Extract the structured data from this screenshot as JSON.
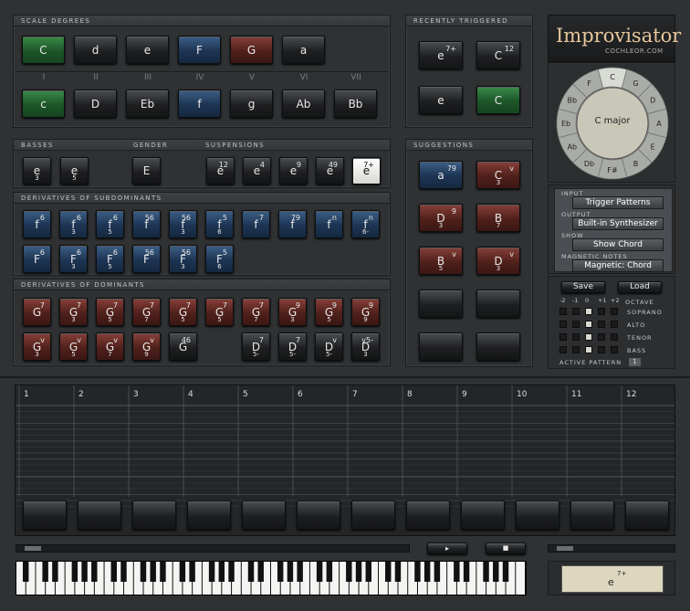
{
  "scale_degrees": {
    "title": "SCALE DEGREES",
    "top": [
      {
        "label": "C",
        "color": "g"
      },
      {
        "label": "d",
        "color": ""
      },
      {
        "label": "e",
        "color": ""
      },
      {
        "label": "F",
        "color": "b"
      },
      {
        "label": "G",
        "color": "rd"
      },
      {
        "label": "a",
        "color": ""
      }
    ],
    "numerals": [
      "I",
      "II",
      "III",
      "IV",
      "V",
      "VI",
      "VII"
    ],
    "bottom": [
      {
        "label": "c",
        "color": "g"
      },
      {
        "label": "D",
        "color": ""
      },
      {
        "label": "Eb",
        "color": ""
      },
      {
        "label": "f",
        "color": "b"
      },
      {
        "label": "g",
        "color": ""
      },
      {
        "label": "Ab",
        "color": ""
      },
      {
        "label": "Bb",
        "color": ""
      }
    ]
  },
  "recently": {
    "title": "RECENTLY TRIGGERED",
    "items": [
      {
        "r": "e",
        "sp": "7+",
        "sb": "",
        "color": ""
      },
      {
        "r": "C",
        "sp": "12",
        "sb": "",
        "color": ""
      },
      {
        "r": "e",
        "sp": "",
        "sb": "",
        "color": ""
      },
      {
        "r": "C",
        "sp": "",
        "sb": "",
        "color": "g"
      }
    ]
  },
  "brand": {
    "title": "Improvisator",
    "site": "COCHLEOR.COM"
  },
  "key_circle": {
    "center": "C major",
    "notes": [
      "C",
      "G",
      "D",
      "A",
      "E",
      "B",
      "F#",
      "Db",
      "Ab",
      "Eb",
      "Bb",
      "F"
    ]
  },
  "basses": {
    "title": "BASSES",
    "items": [
      {
        "r": "e",
        "sb": "3"
      },
      {
        "r": "e",
        "sb": "5"
      }
    ]
  },
  "gender": {
    "title": "GENDER",
    "item": "E"
  },
  "suspensions": {
    "title": "SUSPENSIONS",
    "items": [
      {
        "r": "e",
        "sp": "12",
        "w": false
      },
      {
        "r": "e",
        "sp": "4",
        "w": false
      },
      {
        "r": "e",
        "sp": "9",
        "w": false
      },
      {
        "r": "e",
        "sp": "49",
        "w": false
      },
      {
        "r": "e",
        "sp": "7+",
        "w": true
      }
    ]
  },
  "suggestions": {
    "title": "SUGGESTIONS",
    "items": [
      {
        "r": "a",
        "sp": "79",
        "sb": "",
        "color": "b"
      },
      {
        "r": "C",
        "sp": "v",
        "sb": "3",
        "color": "rd"
      },
      {
        "r": "D",
        "sp": "9",
        "sb": "3",
        "color": "rd"
      },
      {
        "r": "B",
        "sp": "",
        "sb": "7",
        "color": "rd"
      },
      {
        "r": "B",
        "sp": "v",
        "sb": "5",
        "color": "rd"
      },
      {
        "r": "D",
        "sp": "v",
        "sb": "3",
        "color": "rd"
      },
      {
        "r": "",
        "sp": "",
        "sb": "",
        "color": ""
      },
      {
        "r": "",
        "sp": "",
        "sb": "",
        "color": ""
      },
      {
        "r": "",
        "sp": "",
        "sb": "",
        "color": ""
      },
      {
        "r": "",
        "sp": "",
        "sb": "",
        "color": ""
      }
    ]
  },
  "subdominants": {
    "title": "DERIVATIVES OF SUBDOMINANTS",
    "row1": [
      {
        "r": "f",
        "sp": "6",
        "sb": ""
      },
      {
        "r": "f",
        "sp": "6",
        "sb": "3"
      },
      {
        "r": "f",
        "sp": "6",
        "sb": "5"
      },
      {
        "r": "f",
        "sp": "56",
        "sb": ""
      },
      {
        "r": "f",
        "sp": "56",
        "sb": "3"
      },
      {
        "r": "f",
        "sp": "5",
        "sb": "6"
      },
      {
        "r": "f",
        "sp": "7",
        "sb": ""
      },
      {
        "r": "f",
        "sp": "79",
        "sb": ""
      },
      {
        "r": "f",
        "sp": "n",
        "sb": ""
      },
      {
        "r": "f",
        "sp": "n",
        "sb": "6-"
      }
    ],
    "row2": [
      {
        "r": "F",
        "sp": "6",
        "sb": ""
      },
      {
        "r": "F",
        "sp": "6",
        "sb": "3"
      },
      {
        "r": "F",
        "sp": "6",
        "sb": "5"
      },
      {
        "r": "F",
        "sp": "56",
        "sb": ""
      },
      {
        "r": "F",
        "sp": "56",
        "sb": "3"
      },
      {
        "r": "F",
        "sp": "5",
        "sb": "6"
      }
    ]
  },
  "dominants": {
    "title": "DERIVATIVES OF DOMINANTS",
    "row1": [
      {
        "r": "G",
        "sp": "7",
        "sb": ""
      },
      {
        "r": "G",
        "sp": "7",
        "sb": "3"
      },
      {
        "r": "G",
        "sp": "7",
        "sb": "5"
      },
      {
        "r": "G",
        "sp": "7",
        "sb": "7"
      },
      {
        "r": "G",
        "sp": "7",
        "sb": "5"
      },
      {
        "r": "G",
        "sp": "7",
        "sb": "5"
      },
      {
        "r": "G",
        "sp": "7",
        "sb": "7"
      },
      {
        "r": "G",
        "sp": "9",
        "sb": "3"
      },
      {
        "r": "G",
        "sp": "9",
        "sb": "5"
      },
      {
        "r": "G",
        "sp": "9",
        "sb": "9"
      }
    ],
    "row2": [
      {
        "r": "G",
        "sp": "v",
        "sb": "3",
        "c": "rd"
      },
      {
        "r": "G",
        "sp": "v",
        "sb": "5",
        "c": "rd"
      },
      {
        "r": "G",
        "sp": "v",
        "sb": "7",
        "c": "rd"
      },
      {
        "r": "G",
        "sp": "v",
        "sb": "9",
        "c": "rd"
      },
      {
        "r": "G",
        "sp": "46",
        "sb": "",
        "c": ""
      },
      {
        "r": "D",
        "sp": "7",
        "sb": "5-",
        "c": ""
      },
      {
        "r": "D",
        "sp": "7",
        "sb": "5-",
        "c": ""
      },
      {
        "r": "D",
        "sp": "v",
        "sb": "5-",
        "c": ""
      },
      {
        "r": "D",
        "sp": "v5-",
        "sb": "3",
        "c": ""
      }
    ]
  },
  "settings": {
    "input_label": "INPUT",
    "input_value": "Trigger Patterns",
    "output_label": "OUTPUT",
    "output_value": "Built-in Synthesizer",
    "show_label": "SHOW",
    "show_value": "Show Chord",
    "magnetic_label": "MAGNETIC NOTES",
    "magnetic_value": "Magnetic: Chord"
  },
  "voices": {
    "save": "Save",
    "load": "Load",
    "octaves": [
      "-2",
      "-1",
      "0",
      "+1",
      "+2"
    ],
    "octave_label": "OCTAVE",
    "parts": [
      "SOPRANO",
      "ALTO",
      "TENOR",
      "BASS"
    ],
    "active_label": "ACTIVE PATTERN",
    "active_value": "1"
  },
  "pattern": {
    "columns": [
      "1",
      "2",
      "3",
      "4",
      "5",
      "6",
      "7",
      "8",
      "9",
      "10",
      "11",
      "12"
    ]
  },
  "display": {
    "r": "e",
    "sp": "7+"
  }
}
